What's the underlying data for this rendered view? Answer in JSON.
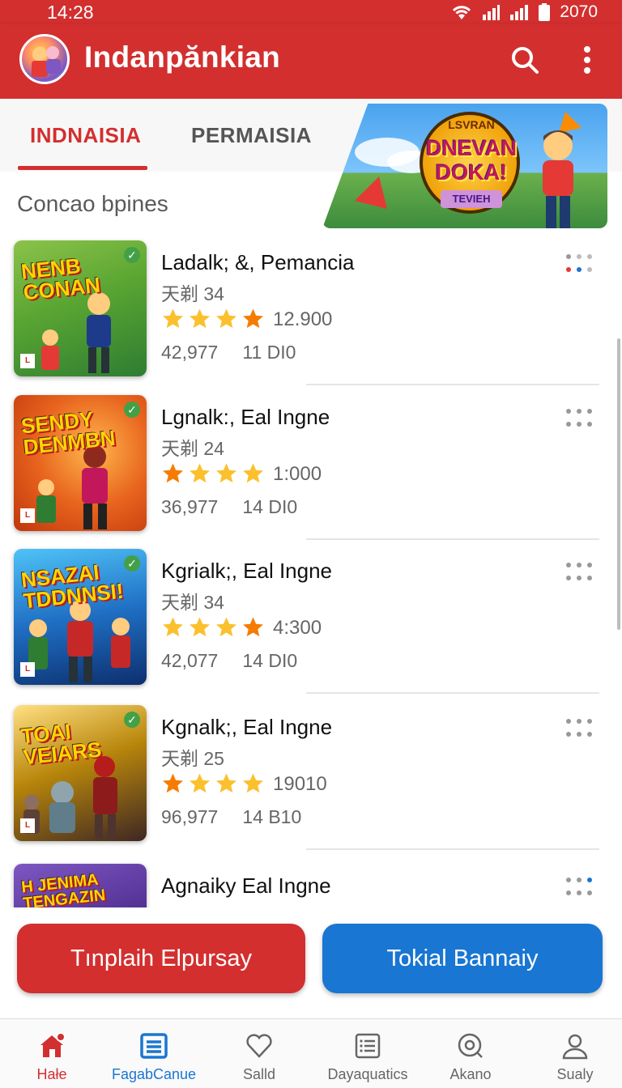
{
  "status_bar": {
    "time": "14:28",
    "battery": "2070"
  },
  "app_bar": {
    "title": "Indanpănkian",
    "search_icon": "search-icon",
    "more_icon": "more-vertical-icon"
  },
  "tabs": [
    {
      "label": "INDNAISIA",
      "active": true
    },
    {
      "label": "PERMAISIA",
      "active": false
    }
  ],
  "banner": {
    "line1": "LSVRAN",
    "line2": "DNEVAN DOKA!",
    "line3": "TEVIEH"
  },
  "section_title": "Concao bpines",
  "games": [
    {
      "cover_text": "NENB CONAN",
      "name": "Ladalk; &, Pemancia",
      "sub": "天剃 34",
      "stars": 4,
      "rating": "12.900",
      "downloads": "42,977",
      "size": "11 DI0",
      "cover_color": "#5aa532"
    },
    {
      "cover_text": "SENDY DENMBN",
      "name": "Lgnalk:, Eal Ingne",
      "sub": "天剃 24",
      "stars": 4,
      "rating": "1:000",
      "downloads": "36,977",
      "size": "14 DI0",
      "cover_color": "#e8641e"
    },
    {
      "cover_text": "NSAZAI TDDNNSI!",
      "name": "Kgrialk;, Eal Ingne",
      "sub": "天剃 34",
      "stars": 4,
      "rating": "4:300",
      "downloads": "42,077",
      "size": "14 DI0",
      "cover_color": "#1f6fc4"
    },
    {
      "cover_text": "TOAI VEIARS",
      "name": "Kgnalk;, Eal Ingne",
      "sub": "天剃 25",
      "stars": 4,
      "rating": "19010",
      "downloads": "96,977",
      "size": "14 B10",
      "cover_color": "#b8860b"
    },
    {
      "cover_text": "H JENIMA TENGAZIN",
      "name": "Agnaiky Eal Ingne",
      "sub": "",
      "stars": 0,
      "rating": "",
      "downloads": "",
      "size": "",
      "cover_color": "#4a2a8a"
    }
  ],
  "buttons": {
    "primary": "Tınplaih Elpursay",
    "secondary": "Tokial Bannaiy"
  },
  "bottom_nav": [
    {
      "label": "Hałe",
      "icon": "home-icon"
    },
    {
      "label": "FagabCanue",
      "icon": "list-icon"
    },
    {
      "label": "Salld",
      "icon": "heart-icon"
    },
    {
      "label": "Dayaquatics",
      "icon": "document-icon"
    },
    {
      "label": "Akano",
      "icon": "compass-icon"
    },
    {
      "label": "Sualy",
      "icon": "profile-icon"
    }
  ],
  "colors": {
    "brand_red": "#d32f2f",
    "accent_blue": "#1976d2",
    "star": "#fbc02d"
  }
}
